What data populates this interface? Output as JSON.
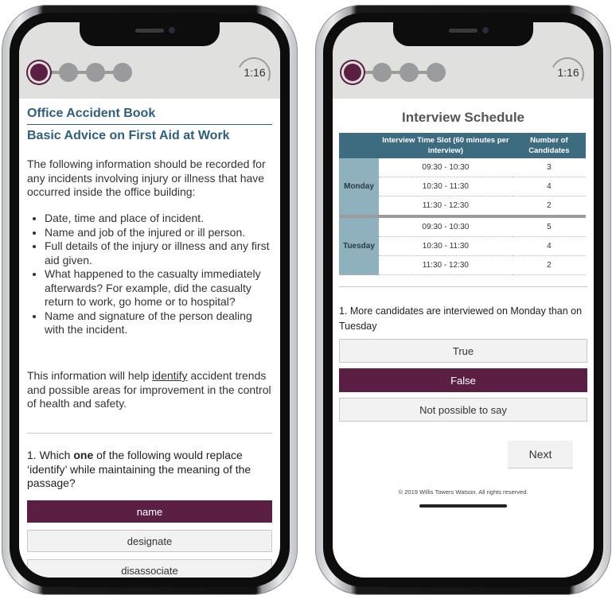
{
  "left": {
    "timer": "1:16",
    "title": "Office Accident Book",
    "subtitle": "Basic Advice on First Aid at Work",
    "intro": "The following information should be recorded for any incidents involving injury or illness that have occurred inside the office building:",
    "bullets": [
      "Date, time and place of incident.",
      "Name and job of the injured or ill person.",
      "Full details of the injury or illness and any first aid given.",
      "What happened to the casualty immediately afterwards? For example, did the casualty return to work, go home or to hospital?",
      "Name and signature of the person dealing with the incident."
    ],
    "closing_before": "This information will help ",
    "closing_keyword": "identify",
    "closing_after": " accident trends and possible areas for improvement in the control of health and safety.",
    "question_prefix": "1. Which ",
    "question_bold": "one",
    "question_suffix": " of the following would replace ‘identify’ while maintaining the meaning of the passage?",
    "options": [
      "name",
      "designate",
      "disassociate"
    ],
    "selected_option": "name"
  },
  "right": {
    "timer": "1:16",
    "title": "Interview Schedule",
    "table": {
      "headers": [
        "",
        "Interview Time Slot (60 minutes per interview)",
        "Number of Candidates"
      ],
      "days": [
        {
          "day": "Monday",
          "rows": [
            [
              "09:30 - 10:30",
              "3"
            ],
            [
              "10:30 - 11:30",
              "4"
            ],
            [
              "11:30 - 12:30",
              "2"
            ]
          ]
        },
        {
          "day": "Tuesday",
          "rows": [
            [
              "09:30 - 10:30",
              "5"
            ],
            [
              "10:30 - 11:30",
              "4"
            ],
            [
              "11:30 - 12:30",
              "2"
            ]
          ]
        }
      ]
    },
    "question": "1. More candidates are interviewed on Monday than on Tuesday",
    "options": [
      "True",
      "False",
      "Not possible to say"
    ],
    "selected_option": "False",
    "next_label": "Next",
    "footer": "© 2019 Willis Towers Watson. All rights reserved."
  },
  "colors": {
    "accent": "#5b1f43",
    "title_blue": "#2f5f7f",
    "table_header": "#3d6b80",
    "table_day": "#8fb0bd",
    "topbar": "#e0e1df",
    "progress_dot": "#9a9b9c"
  },
  "progress": {
    "total_steps": 4,
    "current_step": 1
  }
}
